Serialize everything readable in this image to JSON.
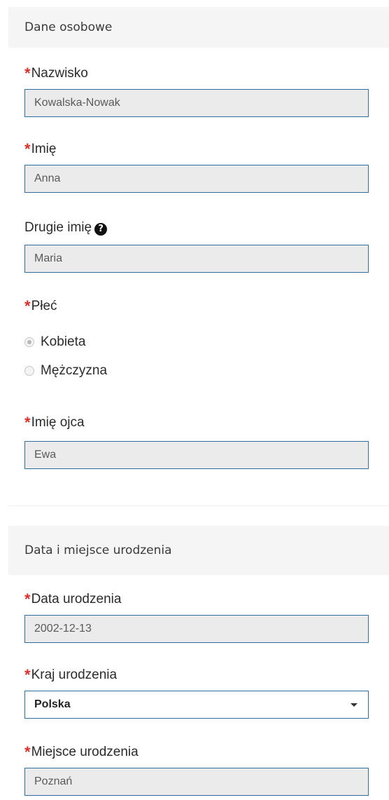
{
  "personal": {
    "header": "Dane osobowe",
    "surname": {
      "label": "Nazwisko",
      "value": "Kowalska-Nowak",
      "required": true
    },
    "first_name": {
      "label": "Imię",
      "value": "Anna",
      "required": true
    },
    "second_name": {
      "label": "Drugie imię",
      "value": "Maria",
      "help_icon": "question-circle-icon"
    },
    "gender": {
      "label": "Płeć",
      "required": true,
      "options": [
        {
          "label": "Kobieta",
          "selected": true
        },
        {
          "label": "Mężczyzna",
          "selected": false
        }
      ]
    },
    "father_name": {
      "label": "Imię ojca",
      "value": "Ewa",
      "required": true
    }
  },
  "birth": {
    "header": "Data i miejsce urodzenia",
    "date": {
      "label": "Data urodzenia",
      "value": "2002-12-13",
      "required": true
    },
    "country": {
      "label": "Kraj urodzenia",
      "value": "Polska",
      "required": true
    },
    "place": {
      "label": "Miejsce urodzenia",
      "value": "Poznań",
      "required": true
    }
  },
  "colors": {
    "required_star": "#d9302c",
    "input_border": "#2f6fa0",
    "input_background": "#ebebeb",
    "header_background": "#f5f5f5"
  },
  "required_marker": "*"
}
